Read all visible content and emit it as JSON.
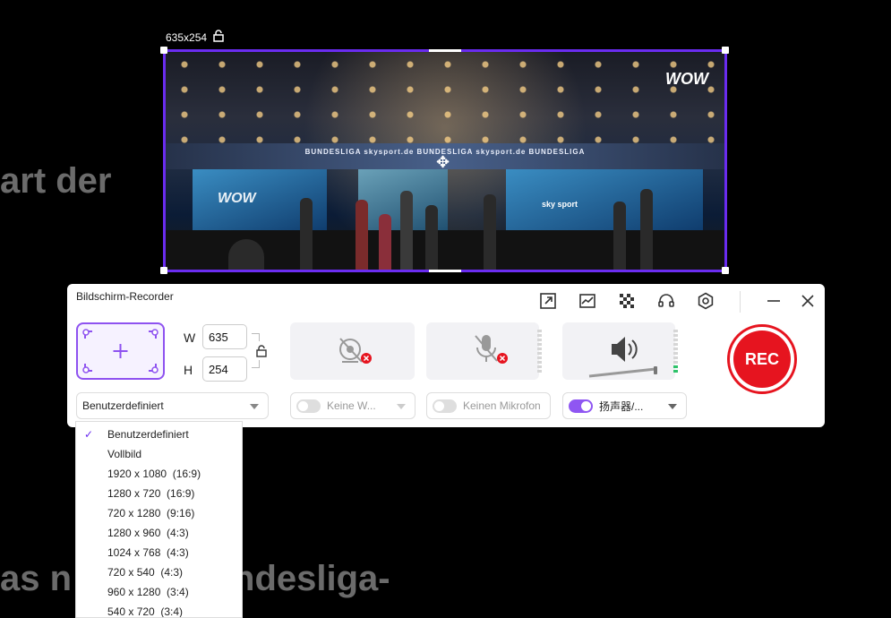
{
  "background": {
    "line1": "art der",
    "line2": "as n      Sport Bundesliga-"
  },
  "capture": {
    "size_label": "635x254",
    "lock_icon": "unlock-icon",
    "overlay_logo": "WOW",
    "overlay_logo_left": "WOW",
    "band_text": "BUNDESLIGA     skysport.de     BUNDESLIGA     skysport.de     BUNDESLIGA",
    "sky_text": "sky sport",
    "move_icon": "move-icon"
  },
  "recorder": {
    "title": "Bildschirm-Recorder",
    "toolbar_icons": [
      "export-icon",
      "chart-icon",
      "checkerboard-icon",
      "headset-icon",
      "settings-icon",
      "minimize-icon",
      "close-icon"
    ],
    "width_label": "W",
    "height_label": "H",
    "width_value": "635",
    "height_value": "254",
    "preset": "Benutzerdefiniert",
    "webcam_label": "Keine W...",
    "mic_label": "Keinen Mikrofon",
    "speaker_label": "扬声器/...",
    "rec_label": "REC",
    "accent": "#8e52f0",
    "rec_color": "#e6141f"
  },
  "menu": {
    "items": [
      "Benutzerdefiniert",
      "Vollbild",
      "1920 x 1080  (16:9)",
      "1280 x 720  (16:9)",
      "720 x 1280  (9:16)",
      "1280 x 960  (4:3)",
      "1024 x 768  (4:3)",
      "720 x 540  (4:3)",
      "960 x 1280  (3:4)",
      "540 x 720  (3:4)"
    ],
    "selected": "Benutzerdefiniert"
  }
}
